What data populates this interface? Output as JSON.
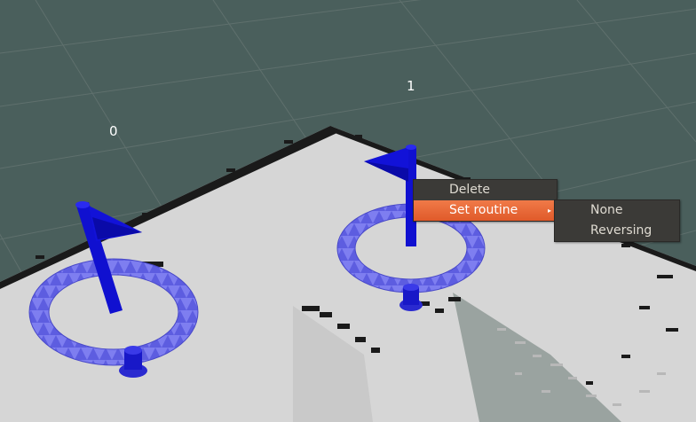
{
  "scene": {
    "background_color": "#4a5f5c",
    "grid_color": "#5f706d",
    "map_floor_color": "#d6d6d6",
    "waypoint_color": "#1010d0",
    "waypoints": [
      {
        "label": "0"
      },
      {
        "label": "1"
      }
    ]
  },
  "context_menu": {
    "items": [
      {
        "label": "Delete"
      },
      {
        "label": "Set routine",
        "arrow": "▸"
      }
    ]
  },
  "submenu": {
    "items": [
      {
        "label": "None"
      },
      {
        "label": "Reversing"
      }
    ]
  },
  "colors": {
    "menu_bg": "#3b3a37",
    "menu_text": "#dfdbd2",
    "highlight": "#e8693a"
  }
}
